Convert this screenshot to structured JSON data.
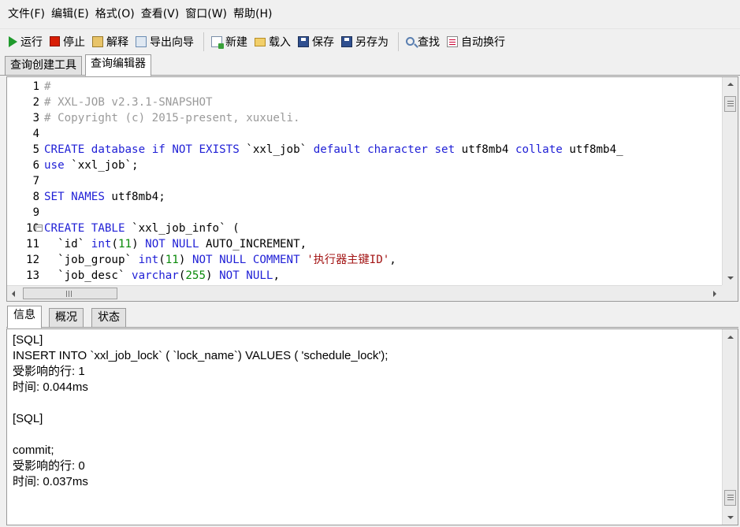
{
  "menu": [
    {
      "label": "文件(F)"
    },
    {
      "label": "编辑(E)"
    },
    {
      "label": "格式(O)"
    },
    {
      "label": "查看(V)"
    },
    {
      "label": "窗口(W)"
    },
    {
      "label": "帮助(H)"
    }
  ],
  "toolbar": {
    "run": "运行",
    "stop": "停止",
    "explain": "解释",
    "export_wizard": "导出向导",
    "new": "新建",
    "load": "载入",
    "save": "保存",
    "save_as": "另存为",
    "find": "查找",
    "word_wrap": "自动换行"
  },
  "top_tabs": [
    {
      "label": "查询创建工具",
      "active": false
    },
    {
      "label": "查询编辑器",
      "active": true
    }
  ],
  "editor": {
    "line_numbers": [
      "1",
      "2",
      "3",
      "4",
      "5",
      "6",
      "7",
      "8",
      "9",
      "10",
      "11",
      "12",
      "13"
    ],
    "lines": [
      [
        {
          "t": "cm",
          "v": "#"
        }
      ],
      [
        {
          "t": "cm",
          "v": "# XXL-JOB v2.3.1-SNAPSHOT"
        }
      ],
      [
        {
          "t": "cm",
          "v": "# Copyright (c) 2015-present, xuxueli."
        }
      ],
      [],
      [
        {
          "t": "kw",
          "v": "CREATE"
        },
        {
          "t": "tx",
          "v": " "
        },
        {
          "t": "kw",
          "v": "database"
        },
        {
          "t": "tx",
          "v": " "
        },
        {
          "t": "kw",
          "v": "if"
        },
        {
          "t": "tx",
          "v": " "
        },
        {
          "t": "kw",
          "v": "NOT"
        },
        {
          "t": "tx",
          "v": " "
        },
        {
          "t": "kw",
          "v": "EXISTS"
        },
        {
          "t": "tx",
          "v": " `xxl_job` "
        },
        {
          "t": "kw",
          "v": "default"
        },
        {
          "t": "tx",
          "v": " "
        },
        {
          "t": "kw",
          "v": "character"
        },
        {
          "t": "tx",
          "v": " "
        },
        {
          "t": "kw",
          "v": "set"
        },
        {
          "t": "tx",
          "v": " utf8mb4 "
        },
        {
          "t": "kw",
          "v": "collate"
        },
        {
          "t": "tx",
          "v": " utf8mb4_"
        }
      ],
      [
        {
          "t": "kw",
          "v": "use"
        },
        {
          "t": "tx",
          "v": " `xxl_job`;"
        }
      ],
      [],
      [
        {
          "t": "kw",
          "v": "SET"
        },
        {
          "t": "tx",
          "v": " "
        },
        {
          "t": "kw",
          "v": "NAMES"
        },
        {
          "t": "tx",
          "v": " utf8mb4;"
        }
      ],
      [],
      [
        {
          "t": "kw",
          "v": "CREATE"
        },
        {
          "t": "tx",
          "v": " "
        },
        {
          "t": "kw",
          "v": "TABLE"
        },
        {
          "t": "tx",
          "v": " `xxl_job_info` ("
        }
      ],
      [
        {
          "t": "tx",
          "v": "  `id` "
        },
        {
          "t": "kw",
          "v": "int"
        },
        {
          "t": "tx",
          "v": "("
        },
        {
          "t": "num",
          "v": "11"
        },
        {
          "t": "tx",
          "v": ") "
        },
        {
          "t": "kw",
          "v": "NOT"
        },
        {
          "t": "tx",
          "v": " "
        },
        {
          "t": "kw",
          "v": "NULL"
        },
        {
          "t": "tx",
          "v": " AUTO_INCREMENT,"
        }
      ],
      [
        {
          "t": "tx",
          "v": "  `job_group` "
        },
        {
          "t": "kw",
          "v": "int"
        },
        {
          "t": "tx",
          "v": "("
        },
        {
          "t": "num",
          "v": "11"
        },
        {
          "t": "tx",
          "v": ") "
        },
        {
          "t": "kw",
          "v": "NOT"
        },
        {
          "t": "tx",
          "v": " "
        },
        {
          "t": "kw",
          "v": "NULL"
        },
        {
          "t": "tx",
          "v": " "
        },
        {
          "t": "kw",
          "v": "COMMENT"
        },
        {
          "t": "tx",
          "v": " "
        },
        {
          "t": "str",
          "v": "'执行器主键ID'"
        },
        {
          "t": "tx",
          "v": ","
        }
      ],
      [
        {
          "t": "tx",
          "v": "  `job_desc` "
        },
        {
          "t": "kw",
          "v": "varchar"
        },
        {
          "t": "tx",
          "v": "("
        },
        {
          "t": "num",
          "v": "255"
        },
        {
          "t": "tx",
          "v": ") "
        },
        {
          "t": "kw",
          "v": "NOT"
        },
        {
          "t": "tx",
          "v": " "
        },
        {
          "t": "kw",
          "v": "NULL"
        },
        {
          "t": "tx",
          "v": ","
        }
      ]
    ],
    "fold_marker": "⊟"
  },
  "hscroll_grip": "III",
  "bottom_tabs": [
    {
      "label": "信息",
      "active": true
    },
    {
      "label": "概况",
      "active": false
    },
    {
      "label": "状态",
      "active": false
    }
  ],
  "output_lines": [
    "[SQL]",
    "INSERT INTO `xxl_job_lock` ( `lock_name`) VALUES ( 'schedule_lock');",
    "受影响的行: 1",
    "时间: 0.044ms",
    "",
    "[SQL]",
    "",
    "commit;",
    "受影响的行: 0",
    "时间: 0.037ms"
  ],
  "colors": {
    "keyword": "#1f1fd6",
    "comment": "#9a9a9a",
    "number": "#0a8a0a",
    "string": "#a31515"
  }
}
